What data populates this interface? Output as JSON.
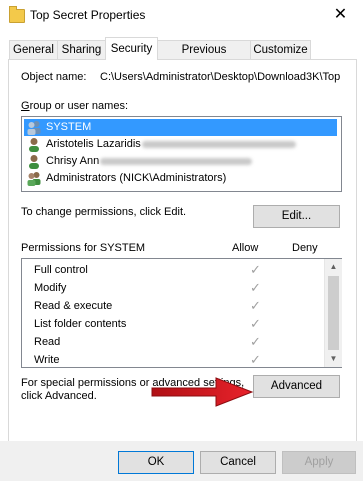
{
  "window": {
    "title": "Top Secret Properties",
    "close_glyph": "✕"
  },
  "tabs": [
    {
      "label": "General",
      "active": false
    },
    {
      "label": "Sharing",
      "active": false
    },
    {
      "label": "Security",
      "active": true
    },
    {
      "label": "Previous Versions",
      "active": false
    },
    {
      "label": "Customize",
      "active": false
    }
  ],
  "security": {
    "object_name_label": "Object name:",
    "object_name_value": "C:\\Users\\Administrator\\Desktop\\Download3K\\Top",
    "group_label": "Group or user names:",
    "users": [
      {
        "name": "SYSTEM",
        "icon": "group-users-icon",
        "selected": true
      },
      {
        "name": "Aristotelis Lazaridis",
        "icon": "user-icon",
        "selected": false,
        "redacted": true
      },
      {
        "name": "Chrisy Ann",
        "icon": "user-icon",
        "selected": false,
        "redacted": true
      },
      {
        "name": "Administrators (NICK\\Administrators)",
        "icon": "group-users-icon",
        "selected": false
      }
    ],
    "change_hint": "To change permissions, click Edit.",
    "edit_button": "Edit...",
    "permissions_label": "Permissions for SYSTEM",
    "allow_header": "Allow",
    "deny_header": "Deny",
    "permissions": [
      {
        "name": "Full control",
        "allow": true,
        "deny": false
      },
      {
        "name": "Modify",
        "allow": true,
        "deny": false
      },
      {
        "name": "Read & execute",
        "allow": true,
        "deny": false
      },
      {
        "name": "List folder contents",
        "allow": true,
        "deny": false
      },
      {
        "name": "Read",
        "allow": true,
        "deny": false
      },
      {
        "name": "Write",
        "allow": true,
        "deny": false
      }
    ],
    "advanced_hint_line1": "For special permissions or advanced settings,",
    "advanced_hint_line2": "click Advanced.",
    "advanced_button": "Advanced"
  },
  "footer": {
    "ok": "OK",
    "cancel": "Cancel",
    "apply": "Apply"
  },
  "colors": {
    "selection": "#3399ff",
    "arrow": "#d0121b",
    "accent": "#0078d7"
  }
}
